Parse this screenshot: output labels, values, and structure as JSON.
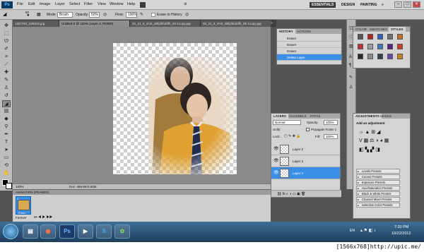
{
  "app": {
    "logo": "Ps",
    "menu": [
      "File",
      "Edit",
      "Image",
      "Layer",
      "Select",
      "Filter",
      "View",
      "Window",
      "Help"
    ],
    "workspaces": [
      "ESSENTIALS",
      "DESIGN",
      "PAINTING",
      "»"
    ],
    "window_controls": [
      "–",
      "□",
      "✕"
    ]
  },
  "options_bar": {
    "mode_label": "Mode:",
    "mode_value": "Brush",
    "opacity_label": "Opacity:",
    "opacity_value": "50%",
    "flow_label": "Flow:",
    "flow_value": "100%",
    "erase_history_label": "Erase to History",
    "brush_size": "50"
  },
  "doc_tabs": [
    "1287292_525042.jpg",
    "Untitled-2 @ 100% (Layer 4, RGB/8)",
    "02_21_6_shirt_d8fyfbfufdfh_04-1copy.jpg",
    "02_21_6_shirt_d8fyfbfufdfh_05-1copy.jpg",
    "02_21_6_shirt_d8fyfbfufdfh_06-1copy.jpg"
  ],
  "status": {
    "zoom": "100%",
    "doc_size": "Doc: 468.8K/2.62M"
  },
  "animation": {
    "title": "ANIMATION (FRAMES)",
    "frame_delay": "0 sec.",
    "frame_number": "1",
    "loop": "Forever"
  },
  "history": {
    "tabs": [
      "HISTORY",
      "ACTIONS"
    ],
    "items": [
      "Eraser",
      "Eraser",
      "Eraser",
      "Delete Layer"
    ],
    "selected": 3
  },
  "layers": {
    "tabs": [
      "LAYERS",
      "CHANNELS",
      "PATHS"
    ],
    "blend_mode": "Normal",
    "opacity_label": "Opacity:",
    "opacity_value": "100%",
    "unify_label": "Unify:",
    "propagate_label": "Propagate Frame 1",
    "lock_label": "Lock:",
    "fill_label": "Fill:",
    "fill_value": "100%",
    "items": [
      "Layer 2",
      "Layer 3",
      "Layer 4"
    ],
    "selected": 2
  },
  "color_panel": {
    "tabs": [
      "COLOR",
      "SWATCHES",
      "STYLES"
    ],
    "style_colors": [
      "#555555",
      "#b22222",
      "#3060c0",
      "#707070",
      "#c07020",
      "#c03030",
      "#9aa0a8",
      "#3a7ac0",
      "#5a2080",
      "#d04020",
      "#2a2a2a",
      "#8a8a8a",
      "#304050",
      "#6a4aa0",
      "#c08020"
    ]
  },
  "adjustments": {
    "tabs": [
      "ADJUSTMENTS",
      "MASKS"
    ],
    "title": "Add an adjustment",
    "presets": [
      "Levels Presets",
      "Curves Presets",
      "Exposure Presets",
      "Hue/Saturation Presets",
      "Black & White Presets",
      "Channel Mixer Presets",
      "Selective Color Presets"
    ]
  },
  "taskbar": {
    "language": "EN",
    "time": "7:20 PM",
    "date": "10/22/2012"
  },
  "watermark": "[1566x768]http://upic.me/"
}
